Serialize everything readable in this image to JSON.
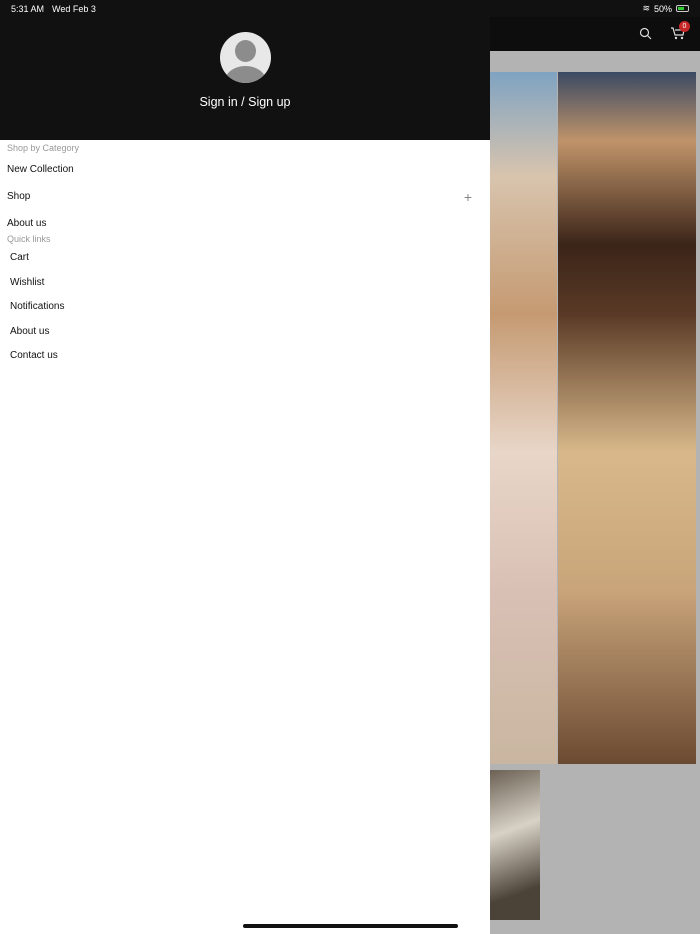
{
  "status_bar": {
    "time": "5:31 AM",
    "date": "Wed Feb 3",
    "battery": "50%"
  },
  "header": {
    "cart_count": "0"
  },
  "drawer": {
    "sign_in": "Sign in / Sign up",
    "category_heading": "Shop by Category",
    "categories": [
      {
        "label": "New Collection"
      },
      {
        "label": "Shop",
        "expand": "+"
      },
      {
        "label": "About us"
      }
    ],
    "quick_links_heading": "Quick links",
    "quick_links": [
      {
        "label": "Cart"
      },
      {
        "label": "Wishlist"
      },
      {
        "label": "Notifications"
      },
      {
        "label": "About us"
      },
      {
        "label": "Contact us"
      }
    ]
  },
  "colors": {
    "badge": "#c62828",
    "header_bg": "#111111"
  }
}
